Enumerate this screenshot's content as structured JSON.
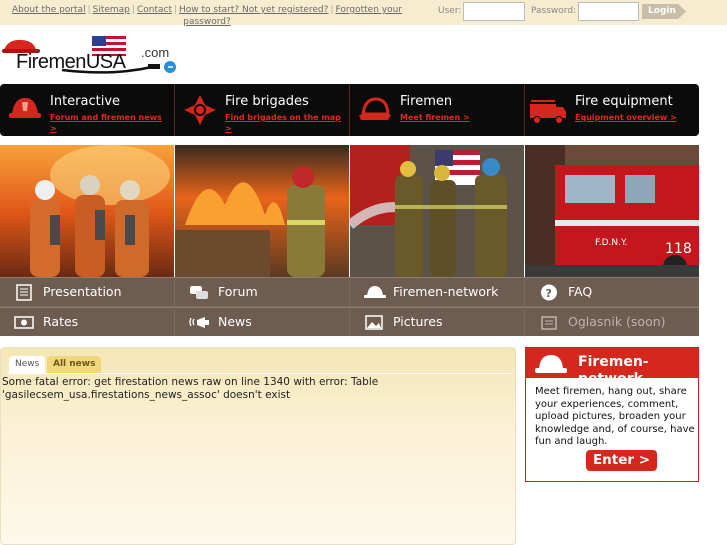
{
  "top_links": {
    "about": "About the portal",
    "sitemap": "Sitemap",
    "contact": "Contact",
    "howto": "How to start? Not yet registered?",
    "forgot": "Forgotten your password?"
  },
  "login": {
    "user_label": "User:",
    "password_label": "Password:",
    "button": "Login"
  },
  "logo": {
    "brand": "FiremenUSA",
    "suffix": ".com"
  },
  "nav": [
    {
      "title": "Interactive",
      "sub": "Forum and firemen news >",
      "icon": "fire-helmet-shield-icon"
    },
    {
      "title": "Fire brigades",
      "sub": "Find brigades on the map >",
      "icon": "maltese-cross-icon"
    },
    {
      "title": "Firemen",
      "sub": "Meet firemen >",
      "icon": "fire-helmet-icon"
    },
    {
      "title": "Fire equipment",
      "sub": "Equipment overview >",
      "icon": "fire-truck-icon"
    }
  ],
  "menu": {
    "row1": [
      "Presentation",
      "Forum",
      "Firemen-network",
      "FAQ"
    ],
    "row2": [
      "Rates",
      "News",
      "Pictures",
      "Oglasnik (soon)"
    ],
    "icons": [
      "presentation-icon",
      "forum-icon",
      "helmet-icon",
      "faq-icon",
      "rates-icon",
      "news-icon",
      "pictures-icon",
      "classifieds-icon"
    ]
  },
  "news": {
    "tabs": [
      "News",
      "All news"
    ],
    "error": "Some fatal error: get firestation news raw on line 1340 with error: Table 'gasilecsem_usa.firestations_news_assoc' doesn't exist"
  },
  "side": {
    "title": "Firemen-network",
    "body": "Meet firemen, hang out, share your experiences, comment, upload pictures, broaden your knowledge and, of course, have fun and laugh.",
    "button": "Enter >"
  },
  "colors": {
    "accent": "#d5271d",
    "nav_bg": "#0b0b0b",
    "menu_bg": "#6e5c51",
    "topbar": "#f6ecd0"
  }
}
